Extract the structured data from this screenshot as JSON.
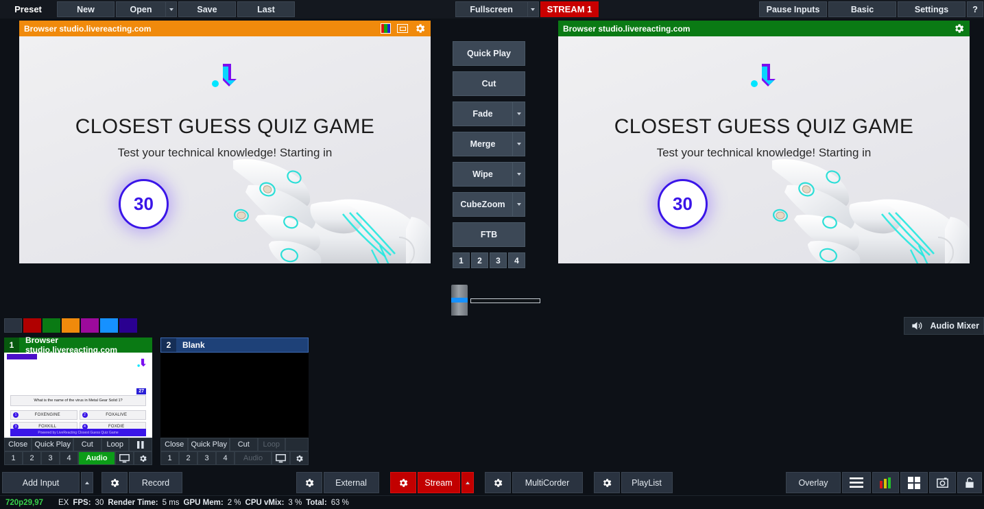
{
  "toolbar": {
    "preset_label": "Preset",
    "new_label": "New",
    "open_label": "Open",
    "save_label": "Save",
    "last_label": "Last",
    "fullscreen_label": "Fullscreen",
    "stream1_label": "STREAM 1",
    "pause_inputs_label": "Pause Inputs",
    "basic_label": "Basic",
    "settings_label": "Settings",
    "help_label": "?",
    "stream_color": "#c90000"
  },
  "preview": {
    "title": "Browser studio.livereacting.com",
    "header_color": "#f08a0c",
    "content": {
      "title": "CLOSEST GUESS QUIZ GAME",
      "subtitle": "Test your technical knowledge! Starting in",
      "countdown": "30",
      "countdown_color": "#3a15e8"
    }
  },
  "program": {
    "title": "Browser studio.livereacting.com",
    "header_color": "#0a7a14",
    "content": {
      "title": "CLOSEST GUESS QUIZ GAME",
      "subtitle": "Test your technical knowledge! Starting in",
      "countdown": "30",
      "countdown_color": "#3a15e8"
    }
  },
  "transitions": {
    "quick_play": "Quick Play",
    "cut": "Cut",
    "fade": "Fade",
    "merge": "Merge",
    "wipe": "Wipe",
    "cubezoom": "CubeZoom",
    "ftb": "FTB",
    "numbers": [
      "1",
      "2",
      "3",
      "4"
    ]
  },
  "audio_mixer": {
    "label": "Audio Mixer"
  },
  "swatches": [
    "#2a3340",
    "#b00000",
    "#0a7a14",
    "#f08a0c",
    "#9c0a9c",
    "#1691ff",
    "#2a0090"
  ],
  "inputs": [
    {
      "number": "1",
      "title": "Browser studio.livereacting.com",
      "state": "live",
      "buttons": {
        "close": "Close",
        "quick_play": "Quick Play",
        "cut": "Cut",
        "loop": "Loop"
      },
      "numbers": [
        "1",
        "2",
        "3",
        "4"
      ],
      "audio_label": "Audio",
      "audio_active": true,
      "loop_active": true,
      "thumb": {
        "badge": "27",
        "question": "What is the name of the virus in  Metal Gear Solid 1?",
        "options": [
          {
            "n": "1",
            "label": "FOXENGINE"
          },
          {
            "n": "2",
            "label": "FOXALIVE"
          },
          {
            "n": "3",
            "label": "FOXKILL"
          },
          {
            "n": "4",
            "label": "FOXDIE"
          }
        ],
        "footer": "Powered by LiveReacting Closest Guess Quiz Game"
      }
    },
    {
      "number": "2",
      "title": "Blank",
      "state": "preview",
      "buttons": {
        "close": "Close",
        "quick_play": "Quick Play",
        "cut": "Cut",
        "loop": "Loop"
      },
      "numbers": [
        "1",
        "2",
        "3",
        "4"
      ],
      "audio_label": "Audio",
      "audio_active": false,
      "loop_active": false
    }
  ],
  "bottom": {
    "add_input": "Add Input",
    "record": "Record",
    "external": "External",
    "stream": "Stream",
    "multicorder": "MultiCorder",
    "playlist": "PlayList",
    "overlay": "Overlay"
  },
  "status": {
    "resolution": "720p29,97",
    "ex": "EX",
    "fps_label": "FPS:",
    "fps_value": "30",
    "render_label": "Render Time:",
    "render_value": "5 ms",
    "gpu_label": "GPU Mem:",
    "gpu_value": "2 %",
    "cpu_label": "CPU vMix:",
    "cpu_value": "3 %",
    "total_label": "Total:",
    "total_value": "63 %"
  }
}
